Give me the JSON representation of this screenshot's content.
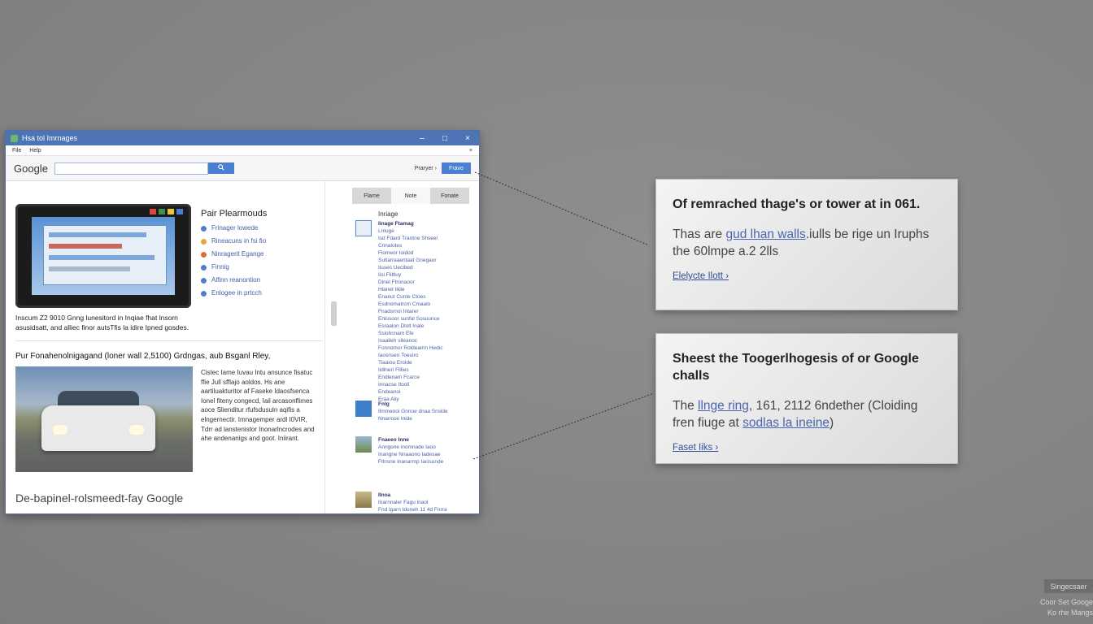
{
  "window": {
    "title": "Hsa tol Imrnages",
    "controls": [
      "–",
      "□",
      "×"
    ]
  },
  "menu": {
    "items": [
      "File",
      "Help"
    ],
    "right": "×"
  },
  "toolbar": {
    "logo": "Google",
    "search_value": "",
    "search_button": "🔍",
    "prefs_label": "Praryer ›",
    "prefs_button": "Fravo"
  },
  "main": {
    "card1": {
      "heading": "Pair Plearmouds",
      "bullets": [
        {
          "label": "Frinager lowede",
          "color": "#4a7fd2"
        },
        {
          "label": "Rineacuns in fsi fio",
          "color": "#e6a43a"
        },
        {
          "label": "Ninragerit Egange",
          "color": "#d9703a"
        },
        {
          "label": "Finnig",
          "color": "#4a7fd2"
        },
        {
          "label": "Alfinn reanontion",
          "color": "#4a7fd2"
        },
        {
          "label": "Enlogee in prtcch",
          "color": "#4a7fd2"
        }
      ],
      "description": "Inscum Z2 9010 Gnng lunesitord in Inqiae fhat lnsorn asusidsatt, and alliec finor autsTfis la idire Ipned gosdes."
    },
    "card2": {
      "title": "Pur Fonahenolnigagand (loner wall  2,5100) Grdngas, aub Bsganl Rley,",
      "description": "Cistec Iame Iuvau Intu ansunce fisatuc ffie Jull sfflajo aoldos. Hs ane aartiluakturitor af Faseke Idaosfsenca Ionel fiteny congecd, Iail arcasonflimes aoce Slienditur rfufsdusuln aqifis a elngernectir. Imnagemper ardl I0VIR, Tdrr ad lanstenistor Inonarlncrodes and ahe andenanigs and goot. Iniirant.",
      "footer_text": "De-bapinel-rolsmeedt-fay Google",
      "colorbar": [
        "#3a9a4a",
        "#e8c63a",
        "#e07a30",
        "#d84a34"
      ]
    }
  },
  "sidebar": {
    "tabs": [
      "Flame",
      "Note",
      "Fonate"
    ],
    "heading": "Inriage",
    "groups": [
      {
        "thumb_color": "#5b86c8",
        "lines": [
          "Iinage Ftamag",
          "Lmuge",
          "Isd Fdard Trantne Shseel",
          "Cnnalotes",
          "Flomeor Ioidod",
          "Sultarraaeritaat Gnegaor",
          "Iiusec Uecibed",
          "Iisl Fliltluy",
          "Dinel Ftronaoor",
          "Hlanet Iilde",
          "Enanut Cunte Ctoes",
          "Esdnomatrcm Cmaalo",
          "Fnadsrnoi Intarer",
          "Enlosoor sunfal Sosuunce",
          "Esraalon Dlolt Inale",
          "Ssiohcnam Efe",
          "Isaalieh slleanoc",
          "Fonnomor Roldeamn Hedic",
          "Iaosnsen Toeuiro",
          "Tiaaiou Erolde",
          "Iidlneri Flllies",
          "Endlenam Fcarce",
          "Innacse Itooli",
          "Endeanoi",
          "Eraa Aiiy"
        ]
      },
      {
        "thumb_color": "#3d7fc9",
        "lines": [
          "Fnlg",
          "Ilmmenoi Gnnoe dnaa Snslde",
          "Nnanose Inide"
        ]
      },
      {
        "thumb_color": "#6a8b4c",
        "lines": [
          "Fnaeeo Inne",
          "Anngone inomnade Iaoo",
          "Inangne Nnaaono Iadesae",
          "Ftlnsne Inanarmp Iacisunde"
        ]
      },
      {
        "thumb_color": "#8a7a4a",
        "lines": [
          "Ilnoa",
          "Inarnnaler Fagu lnaol",
          "Fnd Igarn Iduneh 11 4d Fnrra"
        ]
      }
    ]
  },
  "callouts": [
    {
      "title": "Of remrached thage's or tower at in 061.",
      "body_pre": "Thas are ",
      "body_link": "gud lhan walls",
      "body_post": ".iulls be rige un Iruphs the 60lmpe a.2 2lls",
      "link": "Elelycte Ilott ›"
    },
    {
      "title": "Sheest the Toogerlhogesis of or Google challs",
      "body_pre": "The ",
      "body_link": "llnge ring",
      "body_post": ", 161, 2112 6ndether (Cloiding fren fiuge at ",
      "body_link2": "sodlas la ineine",
      "body_post2": ")",
      "link": "Faset Iiks ›"
    }
  ],
  "corner": {
    "badge": "Singecsaer",
    "line1": "Coor Set Googe",
    "line2": "Ko rhe Mangs"
  }
}
